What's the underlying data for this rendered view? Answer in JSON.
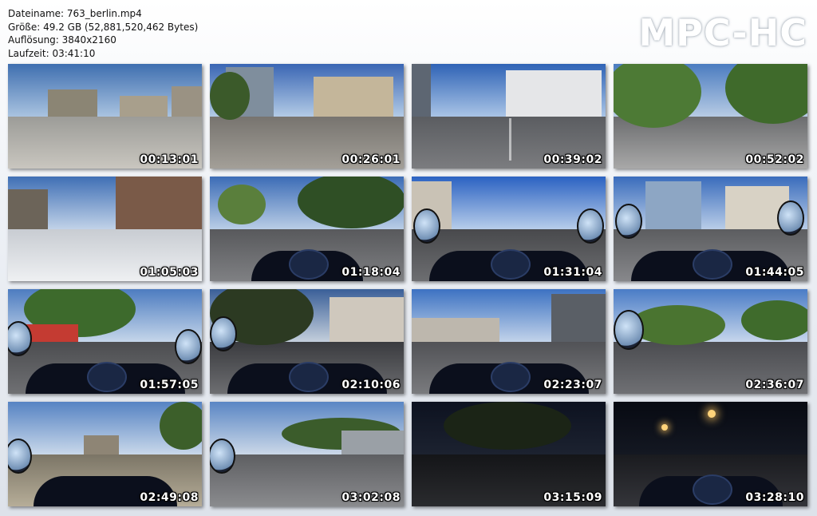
{
  "info": {
    "filename": "Dateiname: 763_berlin.mp4",
    "size": "Größe: 49.2 GB (52,881,520,462 Bytes)",
    "resolution": "Auflösung: 3840x2160",
    "duration": "Laufzeit: 03:41:10"
  },
  "logo": "MPC-HC",
  "thumbnails": [
    {
      "timestamp": "00:13:01"
    },
    {
      "timestamp": "00:26:01"
    },
    {
      "timestamp": "00:39:02"
    },
    {
      "timestamp": "00:52:02"
    },
    {
      "timestamp": "01:05:03"
    },
    {
      "timestamp": "01:18:04"
    },
    {
      "timestamp": "01:31:04"
    },
    {
      "timestamp": "01:44:05"
    },
    {
      "timestamp": "01:57:05"
    },
    {
      "timestamp": "02:10:06"
    },
    {
      "timestamp": "02:23:07"
    },
    {
      "timestamp": "02:36:07"
    },
    {
      "timestamp": "02:49:08"
    },
    {
      "timestamp": "03:02:08"
    },
    {
      "timestamp": "03:15:09"
    },
    {
      "timestamp": "03:28:10"
    }
  ]
}
